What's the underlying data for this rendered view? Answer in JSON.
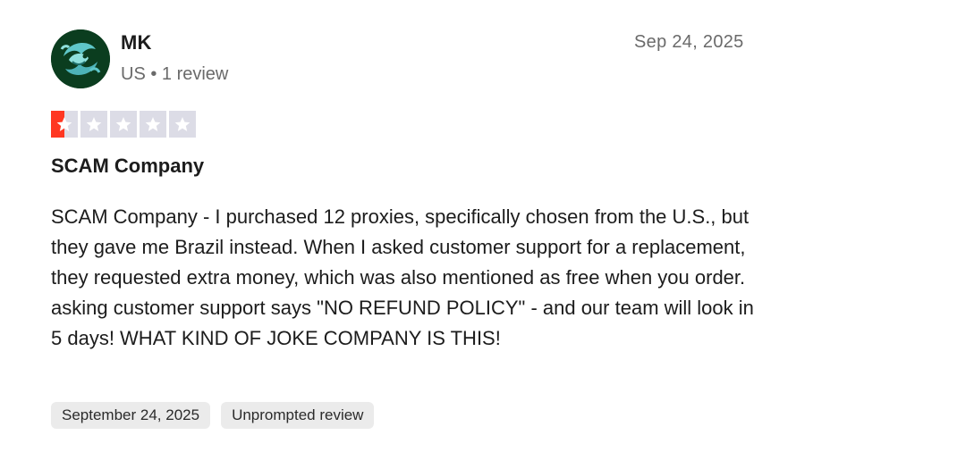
{
  "reviewer": {
    "name": "MK",
    "meta": "US • 1 review",
    "avatar_icon": "fish-avatar-icon"
  },
  "review": {
    "date_short": "Sep 24, 2025",
    "rating": 1,
    "rating_max": 5,
    "star_color": "#ff3722",
    "empty_star_color": "#dcdce6",
    "title": "SCAM Company",
    "body": "SCAM Company - I purchased 12 proxies, specifically chosen from the U.S., but they gave me Brazil instead. When I asked customer support for a replacement, they requested extra money, which was also mentioned as free when you order. asking customer support says \"NO REFUND POLICY\" - and our team will look in 5 days! WHAT KIND OF JOKE COMPANY IS THIS!"
  },
  "tags": [
    {
      "label": "September 24, 2025"
    },
    {
      "label": "Unprompted review"
    }
  ]
}
